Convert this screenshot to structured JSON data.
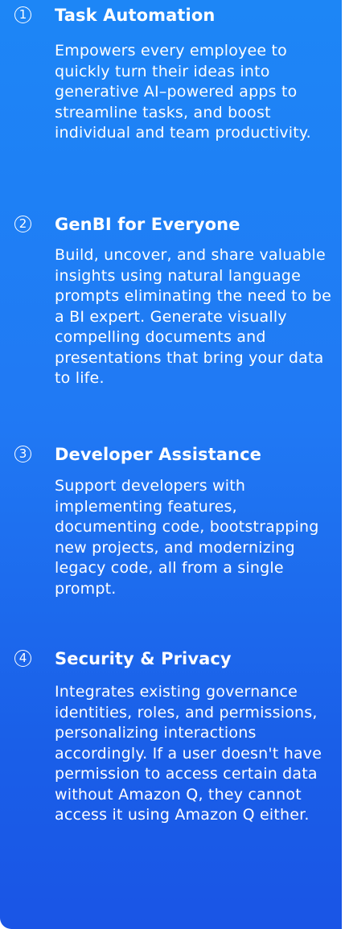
{
  "items": [
    {
      "number": "1",
      "title": "Task Automation",
      "description": "Empowers every employee to quickly turn their ideas into generative AI–powered apps to streamline tasks, and boost individual and team productivity."
    },
    {
      "number": "2",
      "title": "GenBI for Everyone",
      "description": "Build, uncover, and share valuable insights using natural language prompts eliminating the need to be a BI expert. Generate visually compelling documents and presentations that bring your data to life."
    },
    {
      "number": "3",
      "title": "Developer Assistance",
      "description": "Support developers with implementing features, documenting code, bootstrapping new projects, and modernizing legacy code, all from a single prompt."
    },
    {
      "number": "4",
      "title": "Security & Privacy",
      "description": "Integrates existing governance identities, roles, and permissions, personalizing interactions accordingly. If a user doesn't have permission to access certain data without Amazon Q, they cannot access it using Amazon Q either."
    }
  ],
  "colors": {
    "background_top": "#1d86f6",
    "background_bottom": "#1a55e6",
    "text": "#ffffff"
  }
}
